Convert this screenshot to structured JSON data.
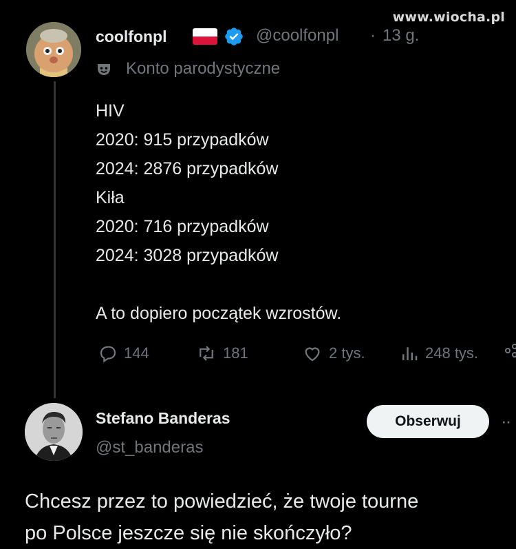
{
  "watermark": "www.wiocha.pl",
  "tweet": {
    "author_name": "coolfonpl",
    "author_handle": "@coolfonpl",
    "separator": "·",
    "time": "13 g.",
    "parody_label": "Konto parodystyczne",
    "lines": [
      "HIV",
      "2020: 915 przypadków",
      "2024: 2876 przypadków",
      "Kiła",
      "2020: 716 przypadków",
      "2024: 3028 przypadków",
      "",
      "A to dopiero początek wzrostów."
    ],
    "actions": {
      "replies": "144",
      "reposts": "181",
      "likes": "2 tys.",
      "views": "248 tys."
    }
  },
  "reply": {
    "author_name": "Stefano Banderas",
    "author_handle": "@st_banderas",
    "follow_label": "Obserwuj",
    "lines": [
      "Chcesz przez to powiedzieć, że twoje tourne",
      "po Polsce jeszcze się nie skończyło?"
    ]
  },
  "colors": {
    "background": "#000000",
    "text": "#e7e9ea",
    "muted": "#71767b",
    "verified": "#1d9bf0"
  }
}
